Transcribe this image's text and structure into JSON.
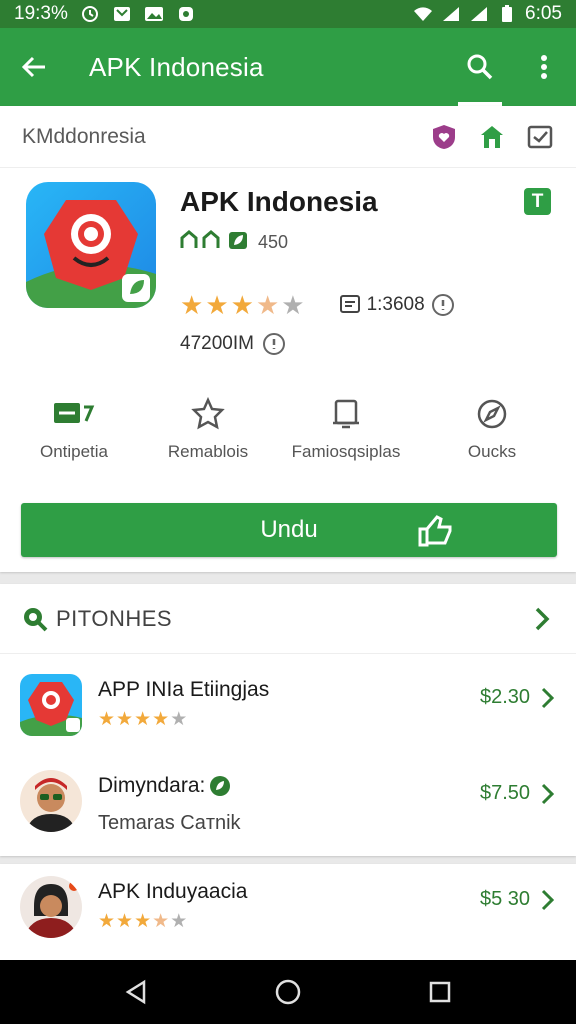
{
  "status_bar": {
    "left_time": "19:3%",
    "right_time": "6:05"
  },
  "app_bar": {
    "title": "APK Indonesia"
  },
  "crumb": "KMddonresia",
  "app": {
    "name": "APK Indonesia",
    "badge": "T",
    "meta": "450",
    "rating_stars": 3.5,
    "rating_count": "1:3608",
    "size": "47200IM"
  },
  "features": [
    {
      "label": "Ontipetia",
      "icon": "calendar-icon"
    },
    {
      "label": "Remablois",
      "icon": "star-outline-icon"
    },
    {
      "label": "Famiosqsiplas",
      "icon": "clipboard-icon"
    },
    {
      "label": "Oucks",
      "icon": "compass-icon"
    }
  ],
  "download": {
    "label": "Undu"
  },
  "section": {
    "title": "PITONHES"
  },
  "list": [
    {
      "title": "APP INIa Etiingjas",
      "price": "$2.30",
      "stars": 4,
      "sub": ""
    },
    {
      "title": "Dimyndara:",
      "price": "$7.50",
      "stars": 0,
      "sub": "Temaras Caтnik"
    },
    {
      "title": "APK Induyaacia",
      "price": "$5 30",
      "stars": 3.5,
      "sub": ""
    }
  ],
  "colors": {
    "green": "#2f9e45",
    "dark_green": "#2e7d32",
    "star": "#f2a93b",
    "star_empty": "#b0b0b0"
  }
}
